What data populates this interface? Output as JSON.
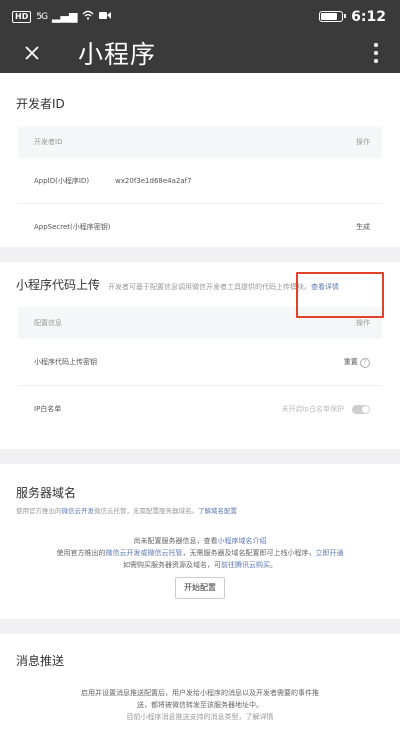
{
  "statusbar": {
    "hd": "HD",
    "signal": "5G",
    "time": "6:12",
    "battery_level": 0.85
  },
  "appbar": {
    "title": "小程序"
  },
  "developer": {
    "section_title": "开发者ID",
    "table_header_left": "开发者ID",
    "table_header_right": "操作",
    "appid_label": "AppID(小程序ID)",
    "appid_value": "wx20f3e1d68e4a2af7",
    "secret_label": "AppSecret(小程序密钥)",
    "secret_action": "生成"
  },
  "upload": {
    "section_title": "小程序代码上传",
    "hint": "开发者可基于配置信息调用微信开发者工具提供的代码上传模块。",
    "hint_link": "查看详情",
    "table_header_left": "配置信息",
    "table_header_right": "操作",
    "key_label": "小程序代码上传密钥",
    "key_action": "重置",
    "ip_label": "IP白名单",
    "ip_status": "未开启ip白名单保护"
  },
  "server": {
    "section_title": "服务器域名",
    "subtitle_a": "使用官方推出的",
    "subtitle_link": "微信云开发",
    "subtitle_b": "微信云托管，无需配置服务器域名。",
    "subtitle_link2": "了解域名配置",
    "desc1_a": "尚未配置服务器信息，查看",
    "desc1_link": "小程序域名介绍",
    "desc2_a": "使用官方推出的",
    "desc2_link": "微信云开发或微信云托管",
    "desc2_b": "，无需服务器及域名配置即可上线小程序，",
    "desc2_link2": "立即开通",
    "desc3_a": "如需购买服务器资源及域名，可",
    "desc3_link": "前往腾讯云购买",
    "desc3_b": "。",
    "start_button": "开始配置"
  },
  "push": {
    "section_title": "消息推送",
    "desc1": "启用并设置消息推送配置后，用户发给小程序的消息以及开发者需要的事件推",
    "desc2": "送，都将被微信转发至该服务器地址中。",
    "desc3": "目前小程序消息推送支持的消息类型，了解详情"
  }
}
